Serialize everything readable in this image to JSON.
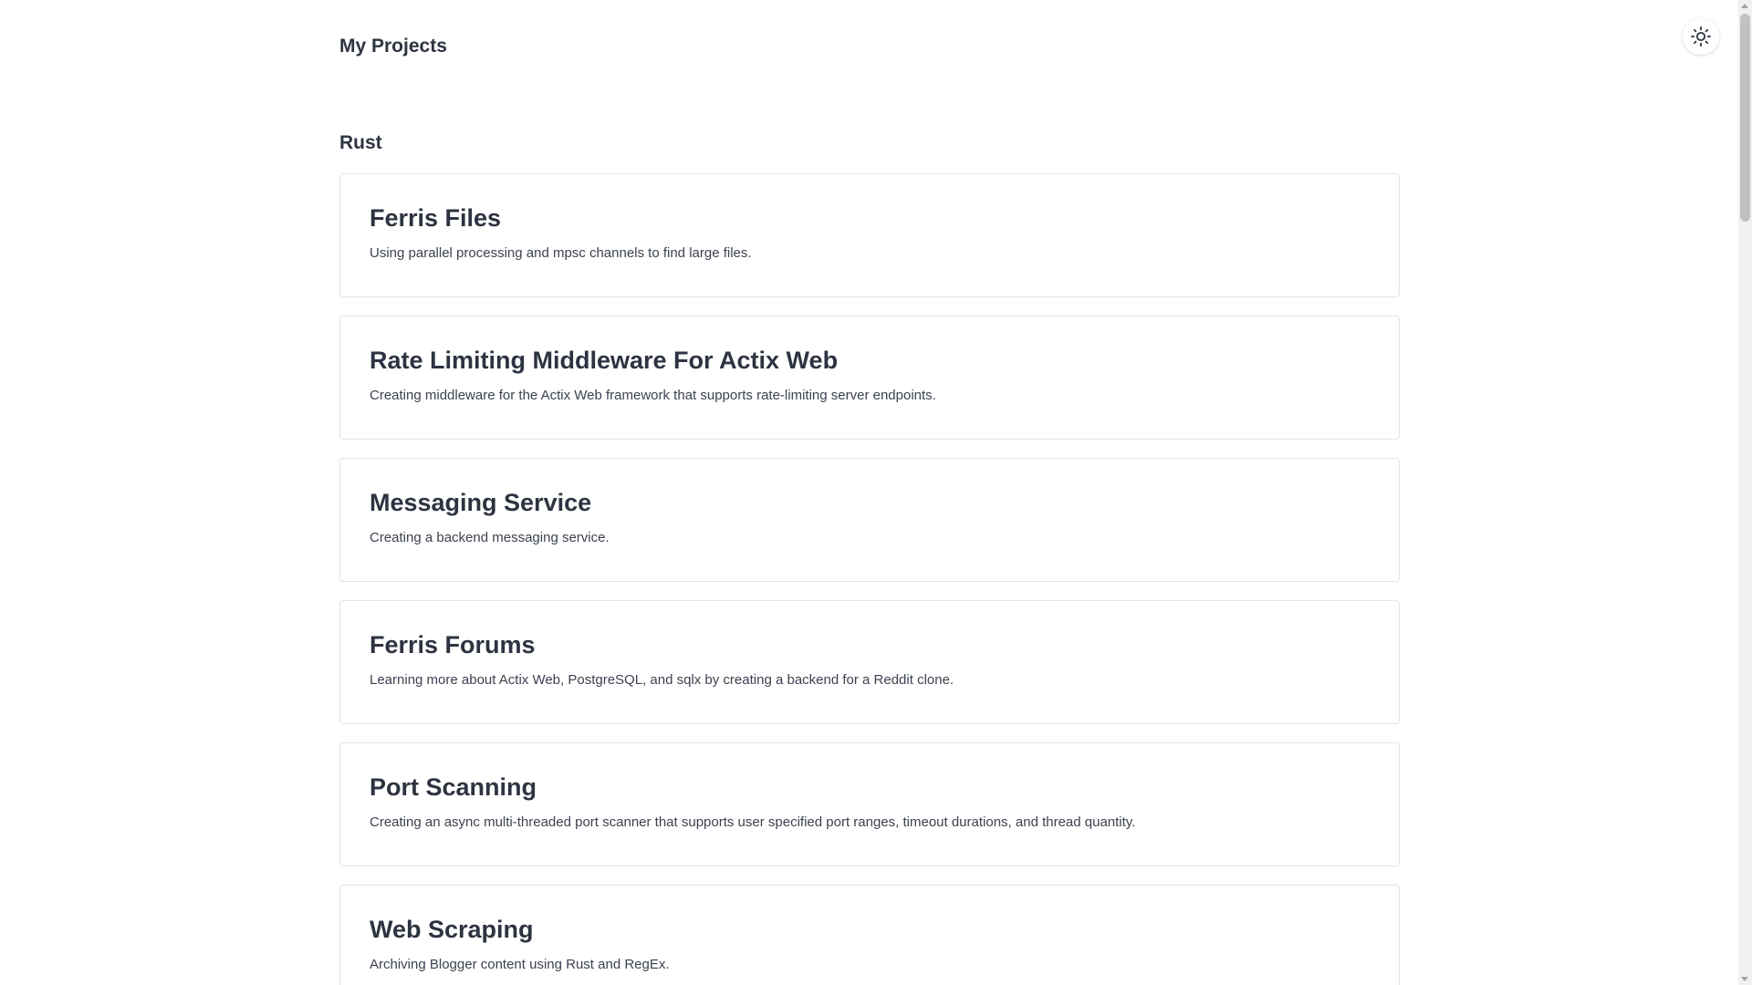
{
  "header": {
    "title": "My Projects",
    "theme_toggle_icon": "sun-icon"
  },
  "section": {
    "title": "Rust"
  },
  "projects": [
    {
      "title": "Ferris Files",
      "description": "Using parallel processing and mpsc channels to find large files."
    },
    {
      "title": "Rate Limiting Middleware For Actix Web",
      "description": "Creating middleware for the Actix Web framework that supports rate-limiting server endpoints."
    },
    {
      "title": "Messaging Service",
      "description": "Creating a backend messaging service."
    },
    {
      "title": "Ferris Forums",
      "description": "Learning more about Actix Web, PostgreSQL, and sqlx by creating a backend for a Reddit clone."
    },
    {
      "title": "Port Scanning",
      "description": "Creating an async multi-threaded port scanner that supports user specified port ranges, timeout durations, and thread quantity."
    },
    {
      "title": "Web Scraping",
      "description": "Archiving Blogger content using Rust and RegEx."
    }
  ],
  "colors": {
    "text": "#2d3340",
    "card_border": "#e2e4e8",
    "background": "#ffffff"
  }
}
